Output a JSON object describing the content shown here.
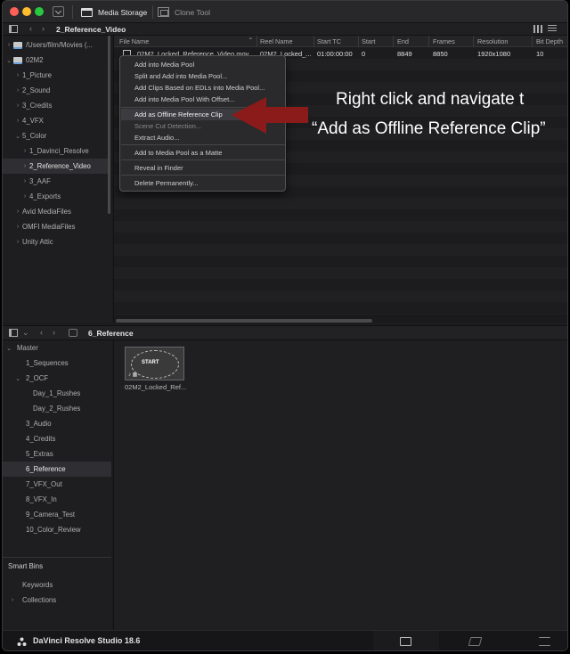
{
  "titlebar": {
    "tabs": [
      {
        "label": "Media Storage",
        "icon": "media-storage-icon"
      },
      {
        "label": "Clone Tool",
        "icon": "clone-tool-icon"
      }
    ]
  },
  "pathbar": {
    "title": "2_Reference_Video"
  },
  "tree": {
    "items": [
      {
        "label": "/Users/film/Movies (...",
        "chevron": "›"
      },
      {
        "label": "02M2",
        "chevron": "⌄"
      },
      {
        "label": "1_Picture",
        "chevron": "›"
      },
      {
        "label": "2_Sound",
        "chevron": "›"
      },
      {
        "label": "3_Credits",
        "chevron": "›"
      },
      {
        "label": "4_VFX",
        "chevron": "›"
      },
      {
        "label": "5_Color",
        "chevron": "⌄"
      },
      {
        "label": "1_Davinci_Resolve",
        "chevron": "›"
      },
      {
        "label": "2_Reference_Video",
        "chevron": "›"
      },
      {
        "label": "3_AAF",
        "chevron": "›"
      },
      {
        "label": "4_Exports",
        "chevron": "›"
      },
      {
        "label": "Avid MediaFiles",
        "chevron": "›"
      },
      {
        "label": "OMFI MediaFiles",
        "chevron": "›"
      },
      {
        "label": "Unity Attic",
        "chevron": "›"
      }
    ]
  },
  "filelist": {
    "columns": [
      "File Name",
      "Reel Name",
      "Start TC",
      "Start",
      "End",
      "Frames",
      "Resolution",
      "Bit Depth"
    ],
    "row": {
      "file_name": "02M2_Locked_Reference_Video.mov",
      "reel_name": "02M2_Locked_...",
      "start_tc": "01:00:00:00",
      "start": "0",
      "end": "8849",
      "frames": "8850",
      "resolution": "1920x1080",
      "bit_depth": "10"
    }
  },
  "context_menu": {
    "items": [
      "Add into Media Pool",
      "Split and Add into Media Pool...",
      "Add Clips Based on EDLs into Media Pool...",
      "Add into Media Pool With Offset...",
      "Add as Offline Reference Clip",
      "Scene Cut Detection...",
      "Extract Audio...",
      "Add to Media Pool as a Matte",
      "Reveal in Finder",
      "Delete Permanently..."
    ]
  },
  "annotation": {
    "line1": "Right click and navigate t",
    "line2": "“Add as Offline Reference Clip”",
    "arrow_color": "#8b1a1a"
  },
  "bottom_toolbar": {
    "title": "6_Reference"
  },
  "bins": {
    "items": [
      {
        "label": "Master",
        "chevron": "⌄"
      },
      {
        "label": "1_Sequences",
        "chevron": ""
      },
      {
        "label": "2_OCF",
        "chevron": "⌄"
      },
      {
        "label": "Day_1_Rushes",
        "chevron": ""
      },
      {
        "label": "Day_2_Rushes",
        "chevron": ""
      },
      {
        "label": "3_Audio",
        "chevron": ""
      },
      {
        "label": "4_Credits",
        "chevron": ""
      },
      {
        "label": "5_Extras",
        "chevron": ""
      },
      {
        "label": "6_Reference",
        "chevron": ""
      },
      {
        "label": "7_VFX_Out",
        "chevron": ""
      },
      {
        "label": "8_VFX_In",
        "chevron": ""
      },
      {
        "label": "9_Camera_Test",
        "chevron": ""
      },
      {
        "label": "10_Color_Review",
        "chevron": ""
      }
    ],
    "smart_bins_title": "Smart Bins",
    "smart_items": [
      {
        "label": "Keywords",
        "chevron": ""
      },
      {
        "label": "Collections",
        "chevron": "›"
      }
    ]
  },
  "viewer": {
    "clip_label": "02M2_Locked_Ref...",
    "thumb_text": "START"
  },
  "footer": {
    "app_title": "DaVinci Resolve Studio 18.6",
    "active_color": "#e0342f"
  }
}
